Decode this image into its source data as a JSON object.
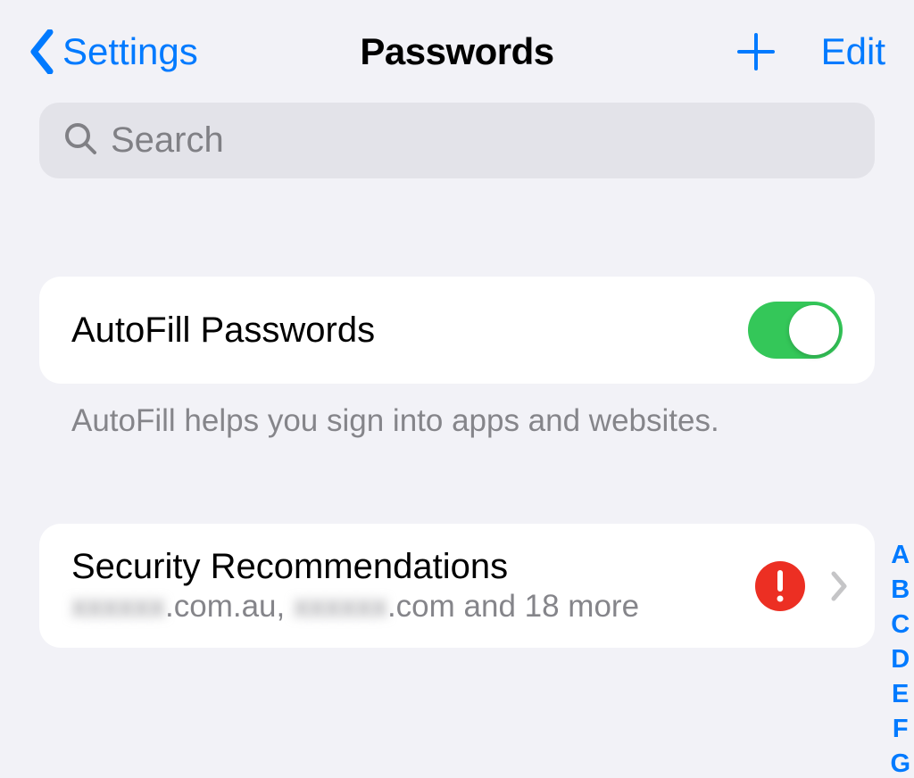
{
  "nav": {
    "back_label": "Settings",
    "title": "Passwords",
    "edit_label": "Edit"
  },
  "search": {
    "placeholder": "Search"
  },
  "autofill": {
    "label": "AutoFill Passwords",
    "enabled": true,
    "footer": "AutoFill helps you sign into apps and websites."
  },
  "security": {
    "title": "Security Recommendations",
    "sub_part1_blur": "xxxxxx",
    "sub_part1": ".com.au, ",
    "sub_part2_blur": "xxxxxx",
    "sub_part2": ".com and 18 more"
  },
  "index": {
    "letters": [
      "A",
      "B",
      "C",
      "D",
      "E",
      "F",
      "G"
    ]
  },
  "colors": {
    "accent": "#007aff",
    "toggle_on": "#34c759",
    "alert": "#ec2f23"
  }
}
